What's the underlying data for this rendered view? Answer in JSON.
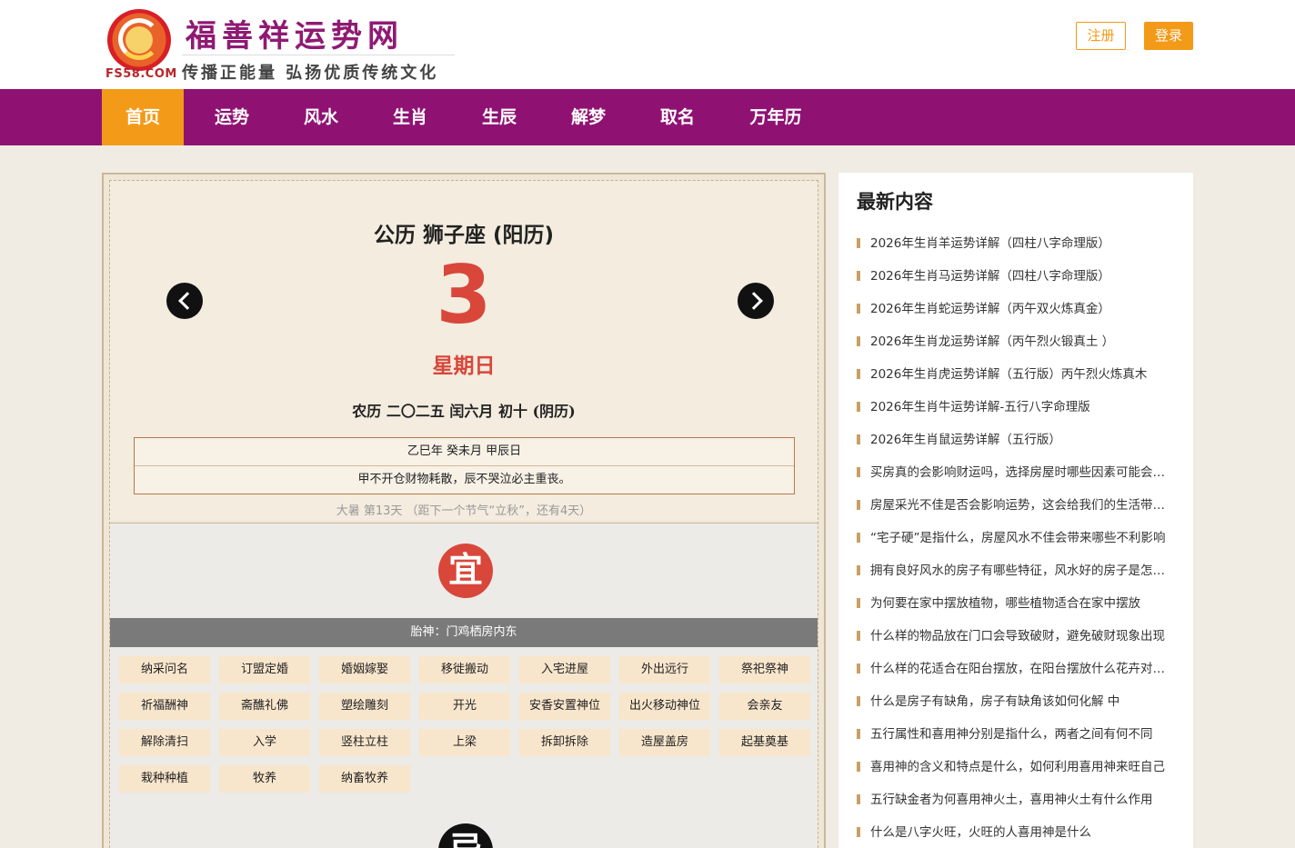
{
  "header": {
    "site_title": "福善祥运势网",
    "domain": "FS58.COM",
    "slogan": "传播正能量 弘扬优质传统文化",
    "register": "注册",
    "login": "登录"
  },
  "nav": {
    "items": [
      "首页",
      "运势",
      "风水",
      "生肖",
      "生辰",
      "解梦",
      "取名",
      "万年历"
    ],
    "active": "首页"
  },
  "calendar": {
    "heading": "公历 狮子座 (阳历)",
    "day": "3",
    "weekday": "星期日",
    "lunar": "农历 二〇二五 闰六月 初十 (阴历)",
    "ganzhi": "乙巳年 癸未月 甲辰日",
    "pengzu": "甲不开仓财物耗散，辰不哭泣必主重丧。",
    "jieqi": "大暑 第13天 （距下一个节气“立秋”，还有4天）",
    "yi_label": "宜",
    "taishen": "胎神：门鸡栖房内东",
    "yi_items": [
      "纳采问名",
      "订盟定婚",
      "婚姻嫁娶",
      "移徙搬动",
      "入宅进屋",
      "外出远行",
      "祭祀祭神",
      "祈福酬神",
      "斋醮礼佛",
      "塑绘雕刻",
      "开光",
      "安香安置神位",
      "出火移动神位",
      "会亲友",
      "解除清扫",
      "入学",
      "竖柱立柱",
      "上梁",
      "拆卸拆除",
      "造屋盖房",
      "起基奠基",
      "栽种种植",
      "牧养",
      "纳畜牧养"
    ],
    "ji_label": "忌"
  },
  "sidebar": {
    "title": "最新内容",
    "items": [
      "2026年生肖羊运势详解（四柱八字命理版）",
      "2026年生肖马运势详解（四柱八字命理版）",
      "2026年生肖蛇运势详解（丙午双火炼真金）",
      "2026年生肖龙运势详解（丙午烈火锻真土 ）",
      "2026年生肖虎运势详解（五行版）丙午烈火炼真木",
      "2026年生肖牛运势详解-五行八字命理版",
      "2026年生肖鼠运势详解（五行版）",
      "买房真的会影响财运吗，选择房屋时哪些因素可能会影响财运",
      "房屋采光不佳是否会影响运势，这会给我们的生活带来什么",
      "“宅子硬”是指什么，房屋风水不佳会带来哪些不利影响",
      "拥有良好风水的房子有哪些特征，风水好的房子是怎样的",
      "为何要在家中摆放植物，哪些植物适合在家中摆放",
      "什么样的物品放在门口会导致破财，避免破财现象出现",
      "什么样的花适合在阳台摆放，在阳台摆放什么花卉对家运好",
      "什么是房子有缺角，房子有缺角该如何化解 中",
      "五行属性和喜用神分别是指什么，两者之间有何不同",
      "喜用神的含义和特点是什么，如何利用喜用神来旺自己",
      "五行缺金者为何喜用神火土，喜用神火土有什么作用",
      "什么是八字火旺，火旺的人喜用神是什么"
    ]
  }
}
